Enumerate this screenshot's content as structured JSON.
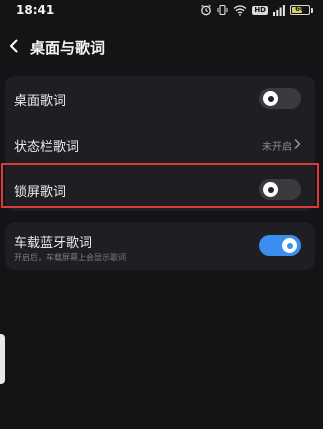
{
  "status_bar": {
    "time": "18:41",
    "network_badge": "HD",
    "battery_level": "60",
    "battery_fraction": 0.6,
    "icons": [
      "alarm-icon",
      "vibrate-icon",
      "wifi-icon",
      "signal-icon",
      "battery-icon"
    ]
  },
  "header": {
    "title": "桌面与歌词",
    "back_icon": "chevron-left-icon"
  },
  "settings": [
    {
      "label": "桌面歌词",
      "control": "toggle",
      "state": "off"
    },
    {
      "label": "状态栏歌词",
      "control": "link",
      "value": "未开启"
    },
    {
      "label": "锁屏歌词",
      "control": "toggle",
      "state": "off",
      "highlighted": true
    }
  ],
  "car": {
    "label": "车载蓝牙歌词",
    "subtitle": "开启后，车载屏幕上会显示歌词",
    "control": "toggle",
    "state": "on"
  },
  "colors": {
    "background": "#141417",
    "card": "#1f1f23",
    "accent": "#3b8ef0",
    "highlight": "#d83a3a"
  }
}
